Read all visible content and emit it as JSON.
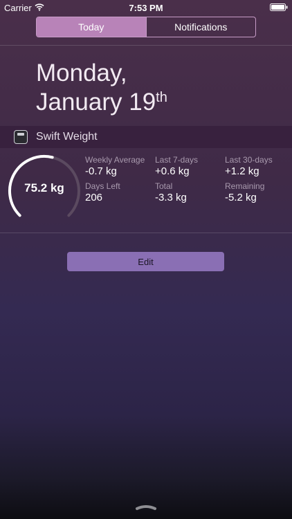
{
  "status_bar": {
    "carrier": "Carrier",
    "time": "7:53 PM",
    "icons": [
      "wifi-icon",
      "battery-icon"
    ]
  },
  "segmented_control": {
    "tabs": [
      {
        "label": "Today",
        "selected": true
      },
      {
        "label": "Notifications",
        "selected": false
      }
    ]
  },
  "date": {
    "line1": "Monday,",
    "line2": "January 19",
    "suffix": "th"
  },
  "widget": {
    "title": "Swift Weight",
    "icon": "scale-icon",
    "current_weight": "75.2 kg",
    "gauge_fill_fraction": 0.55,
    "stats": [
      {
        "label": "Weekly Average",
        "value": "-0.7 kg"
      },
      {
        "label": "Last 7-days",
        "value": "+0.6 kg"
      },
      {
        "label": "Last 30-days",
        "value": "+1.2 kg"
      },
      {
        "label": "Days Left",
        "value": "206"
      },
      {
        "label": "Total",
        "value": "-3.3 kg"
      },
      {
        "label": "Remaining",
        "value": "-5.2 kg"
      }
    ]
  },
  "edit_button": {
    "label": "Edit"
  },
  "colors": {
    "segment_active": "#b883b8",
    "edit_button": "#8a6fb4",
    "stat_label": "#a99aae"
  }
}
